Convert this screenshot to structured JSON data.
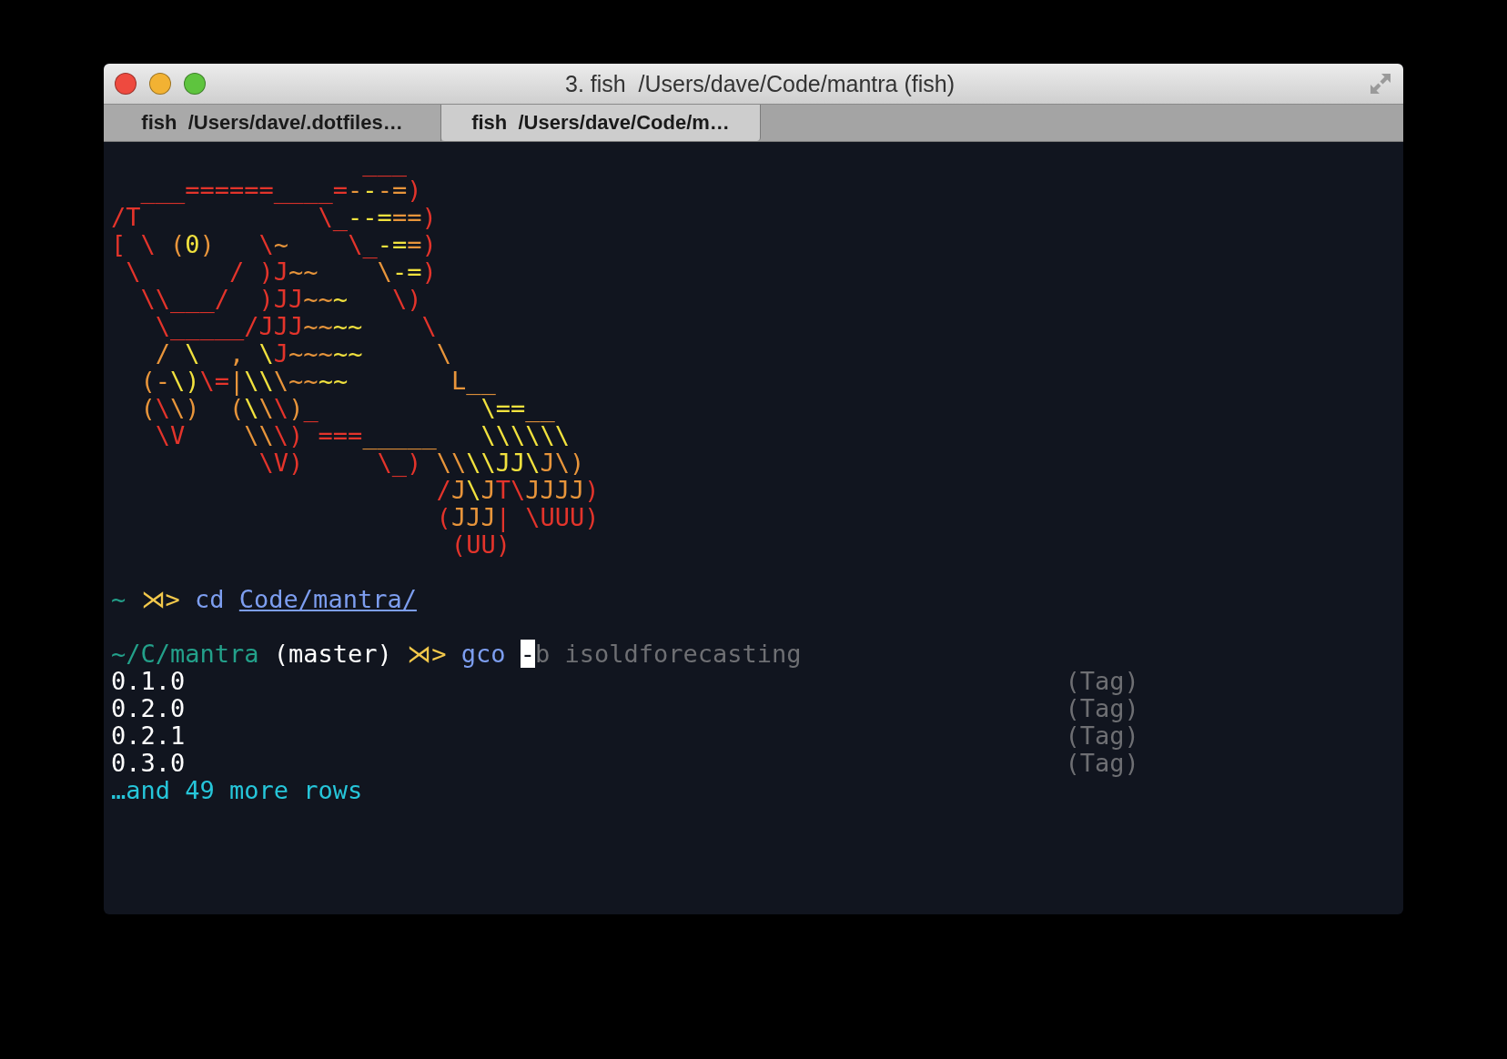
{
  "window": {
    "title": "3. fish  /Users/dave/Code/mantra (fish)"
  },
  "tabs": [
    {
      "label": "fish  /Users/dave/.dotfiles…",
      "selected": false
    },
    {
      "label": "fish  /Users/dave/Code/m…",
      "selected": true
    }
  ],
  "art": [
    [
      {
        "text": "                 ___",
        "color": "#e3342b"
      }
    ],
    [
      {
        "text": "  ___======____=",
        "color": "#e3342b"
      },
      {
        "text": "-",
        "color": "#e8953b"
      },
      {
        "text": "-",
        "color": "#f2e23e"
      },
      {
        "text": "-=",
        "color": "#e8953b"
      },
      {
        "text": ")",
        "color": "#e3342b"
      }
    ],
    [
      {
        "text": "/T            \\_",
        "color": "#e3342b"
      },
      {
        "text": "--=",
        "color": "#f2e23e"
      },
      {
        "text": "==",
        "color": "#e8953b"
      },
      {
        "text": ")",
        "color": "#e3342b"
      }
    ],
    [
      {
        "text": "[ \\ ",
        "color": "#e3342b"
      },
      {
        "text": "(",
        "color": "#e8953b"
      },
      {
        "text": "0",
        "color": "#f2e23e"
      },
      {
        "text": ")",
        "color": "#e8953b"
      },
      {
        "text": "   \\",
        "color": "#e3342b"
      },
      {
        "text": "~",
        "color": "#e8953b"
      },
      {
        "text": "    \\_",
        "color": "#e3342b"
      },
      {
        "text": "-=",
        "color": "#f2e23e"
      },
      {
        "text": "=",
        "color": "#e8953b"
      },
      {
        "text": ")",
        "color": "#e3342b"
      }
    ],
    [
      {
        "text": " \\      / )J",
        "color": "#e3342b"
      },
      {
        "text": "~~    \\",
        "color": "#e8953b"
      },
      {
        "text": "-=",
        "color": "#f2e23e"
      },
      {
        "text": ")",
        "color": "#e3342b"
      }
    ],
    [
      {
        "text": "  \\\\___/  )JJ",
        "color": "#e3342b"
      },
      {
        "text": "~~",
        "color": "#e8953b"
      },
      {
        "text": "~",
        "color": "#f2e23e"
      },
      {
        "text": "   \\)",
        "color": "#e3342b"
      }
    ],
    [
      {
        "text": "   \\_____/JJJ",
        "color": "#e3342b"
      },
      {
        "text": "~~",
        "color": "#e8953b"
      },
      {
        "text": "~~",
        "color": "#f2e23e"
      },
      {
        "text": "    \\",
        "color": "#e3342b"
      }
    ],
    [
      {
        "text": "   /",
        "color": "#e8953b"
      },
      {
        "text": " \\",
        "color": "#f2e23e"
      },
      {
        "text": "  ,",
        "color": "#e8953b"
      },
      {
        "text": " \\",
        "color": "#f2e23e"
      },
      {
        "text": "J",
        "color": "#e3342b"
      },
      {
        "text": "~~~",
        "color": "#e8953b"
      },
      {
        "text": "~~",
        "color": "#f2e23e"
      },
      {
        "text": "     \\",
        "color": "#e8953b"
      }
    ],
    [
      {
        "text": "  (-",
        "color": "#e8953b"
      },
      {
        "text": "\\)",
        "color": "#f2e23e"
      },
      {
        "text": "\\=",
        "color": "#e3342b"
      },
      {
        "text": "|",
        "color": "#e8953b"
      },
      {
        "text": "\\\\",
        "color": "#f2e23e"
      },
      {
        "text": "\\~~",
        "color": "#e8953b"
      },
      {
        "text": "~~",
        "color": "#f2e23e"
      },
      {
        "text": "       L__",
        "color": "#e8953b"
      }
    ],
    [
      {
        "text": "  (",
        "color": "#e8953b"
      },
      {
        "text": "\\",
        "color": "#e3342b"
      },
      {
        "text": "\\)  (",
        "color": "#e8953b"
      },
      {
        "text": "\\",
        "color": "#f2e23e"
      },
      {
        "text": "\\",
        "color": "#e8953b"
      },
      {
        "text": "\\",
        "color": "#e3342b"
      },
      {
        "text": ")",
        "color": "#e8953b"
      },
      {
        "text": "_",
        "color": "#e3342b"
      },
      {
        "text": "           \\==",
        "color": "#f2e23e"
      },
      {
        "text": "__",
        "color": "#e8953b"
      }
    ],
    [
      {
        "text": "   \\V",
        "color": "#e3342b"
      },
      {
        "text": "    \\\\",
        "color": "#e8953b"
      },
      {
        "text": "\\) ===",
        "color": "#e3342b"
      },
      {
        "text": "_____",
        "color": "#e8953b"
      },
      {
        "text": "   \\\\\\\\\\\\",
        "color": "#f2e23e"
      }
    ],
    [
      {
        "text": "          \\V)     \\_)",
        "color": "#e3342b"
      },
      {
        "text": " \\\\",
        "color": "#e8953b"
      },
      {
        "text": "\\\\JJ\\",
        "color": "#f2e23e"
      },
      {
        "text": "J\\)",
        "color": "#e8953b"
      }
    ],
    [
      {
        "text": "                      /",
        "color": "#e3342b"
      },
      {
        "text": "J",
        "color": "#e8953b"
      },
      {
        "text": "\\",
        "color": "#f2e23e"
      },
      {
        "text": "J",
        "color": "#e8953b"
      },
      {
        "text": "T\\",
        "color": "#e3342b"
      },
      {
        "text": "JJJJ",
        "color": "#e8953b"
      },
      {
        "text": ")",
        "color": "#e3342b"
      }
    ],
    [
      {
        "text": "                      (",
        "color": "#e3342b"
      },
      {
        "text": "JJJ",
        "color": "#e8953b"
      },
      {
        "text": "| \\UUU)",
        "color": "#e3342b"
      }
    ],
    [
      {
        "text": "                       (UU)",
        "color": "#e3342b"
      }
    ]
  ],
  "history": [
    {
      "cwd": "~",
      "prompt": "⋊>",
      "command": "cd",
      "argument": "Code/mantra/"
    }
  ],
  "current": {
    "cwd": "~/C/mantra",
    "branch": "(master)",
    "prompt": "⋊>",
    "command": "gco",
    "cursor_char": "-",
    "suggestion": "b isoldforecasting"
  },
  "completions": [
    {
      "value": "0.1.0",
      "type": "(Tag)"
    },
    {
      "value": "0.2.0",
      "type": "(Tag)"
    },
    {
      "value": "0.2.1",
      "type": "(Tag)"
    },
    {
      "value": "0.3.0",
      "type": "(Tag)"
    }
  ],
  "more": "…and 49 more rows"
}
